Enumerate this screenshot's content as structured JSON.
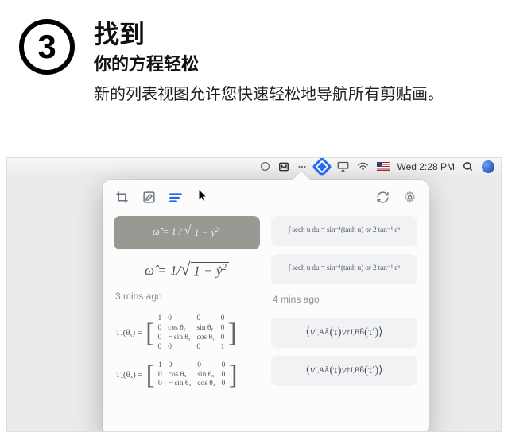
{
  "step": {
    "number": "3",
    "title": "找到",
    "subtitle": "你的方程轻松",
    "description": "新的列表视图允许您快速轻松地导航所有剪贴画。"
  },
  "menubar": {
    "clock": "Wed 2:28 PM"
  },
  "popover": {
    "toolbar": {
      "crop": "crop",
      "edit": "edit",
      "list": "list",
      "refresh": "refresh",
      "settings": "settings"
    },
    "left": {
      "thumb_eq": "ω̂ = 1 / √(1 − ẏ²)",
      "eq_large_html": "ω̂ = 1 / √(1 − ẏ²)",
      "timestamp": "3 mins ago",
      "matrix1_label": "Tᵧ(θᵧ) =",
      "matrix1_rows": [
        [
          "1",
          "0",
          "0",
          "0"
        ],
        [
          "0",
          "cos θᵧ",
          "sin θᵧ",
          "0"
        ],
        [
          "0",
          "− sin θᵧ",
          "cos θᵧ",
          "0"
        ],
        [
          "0",
          "0",
          "0",
          "1"
        ]
      ],
      "matrix2_label": "Tₓ(θₓ) =",
      "matrix2_rows": [
        [
          "1",
          "0",
          "0",
          "0"
        ],
        [
          "0",
          "cos θₓ",
          "sin θₓ",
          "0"
        ],
        [
          "0",
          "− sin θₓ",
          "cos θₓ",
          "0"
        ]
      ]
    },
    "right": {
      "int1": "∫ sech u du = sin⁻¹(tanh u) or 2 tan⁻¹ eᵘ",
      "int2": "∫ sech u du = sin⁻¹(tanh u) or 2 tan⁻¹ eᵘ",
      "timestamp": "4 mins ago",
      "braket1": "⟨ v_{I,AĀ}(τ) v†_{J,BB̄}(τ′) ⟩",
      "braket2": "⟨ v_{I,AĀ}(τ) v†_{J,BB̄}(τ′) ⟩"
    }
  }
}
